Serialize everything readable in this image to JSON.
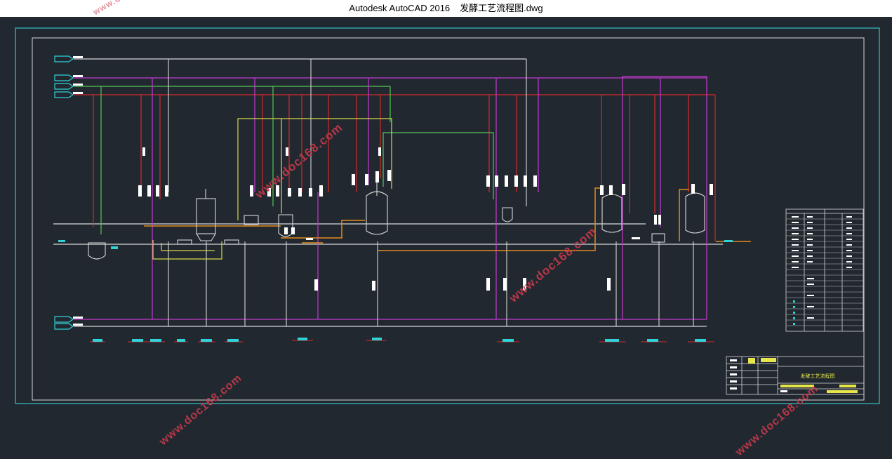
{
  "window": {
    "app_title": "Autodesk AutoCAD 2016",
    "file_name": "发酵工艺流程图.dwg"
  },
  "watermarks": [
    "www.docin.com",
    "www.doc168.com",
    "www.doc168.com",
    "www.doc168.com",
    "www.doc168.com"
  ],
  "colors": {
    "background": "#212830",
    "border": "#33c3c8",
    "steam_red": "#d22b2b",
    "magenta": "#c43ad0",
    "green": "#55c455",
    "yellow": "#d8d84a",
    "orange": "#e38b1f",
    "white_line": "#d8d8d8",
    "tag_cyan": "#31d2d6"
  },
  "title_block": {
    "title": "发酵工艺流程图"
  }
}
